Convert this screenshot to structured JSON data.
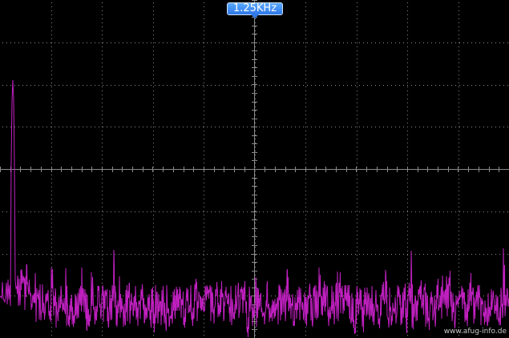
{
  "display": {
    "trigger_frequency_label": "1.25KHz",
    "watermark": "www.afug-info.de"
  },
  "colors": {
    "background": "#000000",
    "grid": "#8a8a8a",
    "trace": "#c020c0",
    "marker": "#3a86f0",
    "marker_text": "#ffffff"
  },
  "icons": {
    "trigger_pointer": "down-triangle-icon"
  }
}
